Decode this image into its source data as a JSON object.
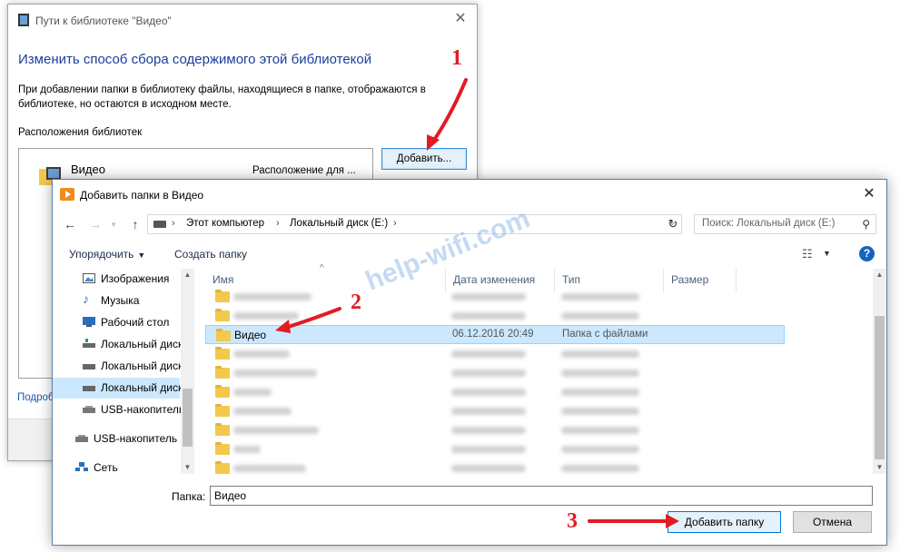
{
  "lib_dialog": {
    "title": "Пути к библиотеке \"Видео\"",
    "heading": "Изменить способ сбора содержимого этой библиотекой",
    "description": "При добавлении папки в библиотеку файлы, находящиеся в папке, отображаются в библиотеке, но остаются в исходном месте.",
    "locations_label": "Расположения библиотек",
    "location_item": {
      "name": "Видео",
      "path": "Расположение для ..."
    },
    "add_button": "Добавить...",
    "footer_link": "Подроб"
  },
  "add_dialog": {
    "title": "Добавить папки в Видео",
    "breadcrumbs": [
      "Этот компьютер",
      "Локальный диск (E:)"
    ],
    "search_placeholder": "Поиск: Локальный диск (E:)",
    "toolbar": {
      "organize": "Упорядочить",
      "new_folder": "Создать папку"
    },
    "nav_items": [
      {
        "label": "Изображения",
        "icon": "pictures-icon"
      },
      {
        "label": "Музыка",
        "icon": "music-icon"
      },
      {
        "label": "Рабочий стол",
        "icon": "desktop-icon"
      },
      {
        "label": "Локальный диск",
        "icon": "network-drive-icon"
      },
      {
        "label": "Локальный диск",
        "icon": "drive-icon"
      },
      {
        "label": "Локальный диск",
        "icon": "drive-icon",
        "selected": true
      },
      {
        "label": "USB-накопитель",
        "icon": "usb-drive-icon"
      },
      {
        "label": "USB-накопитель",
        "icon": "usb-drive-icon"
      },
      {
        "label": "Сеть",
        "icon": "network-icon"
      }
    ],
    "columns": {
      "name": "Имя",
      "date": "Дата изменения",
      "type": "Тип",
      "size": "Размер"
    },
    "selected_row": {
      "name": "Видео",
      "date": "06.12.2016 20:49",
      "type": "Папка с файлами"
    },
    "folder_label": "Папка:",
    "folder_value": "Видео",
    "add_folder_button": "Добавить папку",
    "cancel_button": "Отмена"
  },
  "annotations": {
    "step1": "1",
    "step2": "2",
    "step3": "3",
    "watermark": "help-wifi.com",
    "arrow_color": "#e31b23"
  }
}
